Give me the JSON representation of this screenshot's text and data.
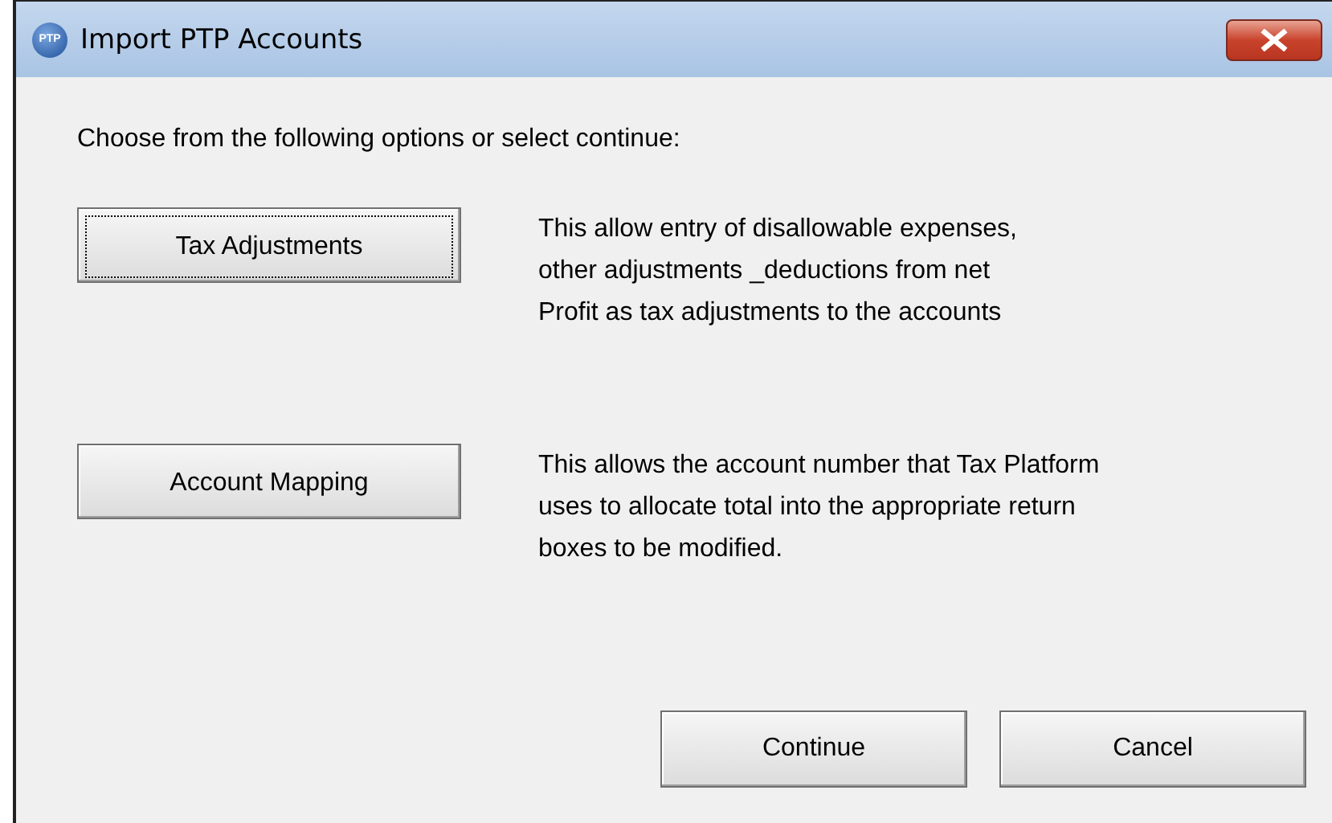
{
  "window": {
    "title": "Import PTP Accounts",
    "icon_text": "PTP"
  },
  "prompt": "Choose from the following options or select continue:",
  "options": [
    {
      "label": "Tax Adjustments",
      "focused": true,
      "description": [
        "This allow entry of disallowable expenses,",
        "other adjustments _deductions from net",
        "Profit as tax adjustments to the accounts"
      ]
    },
    {
      "label": "Account Mapping",
      "focused": false,
      "description": [
        "This allows the account number that Tax Platform",
        "uses to allocate total into the appropriate return",
        "boxes to be modified."
      ]
    }
  ],
  "buttons": [
    "Continue",
    "Cancel"
  ]
}
